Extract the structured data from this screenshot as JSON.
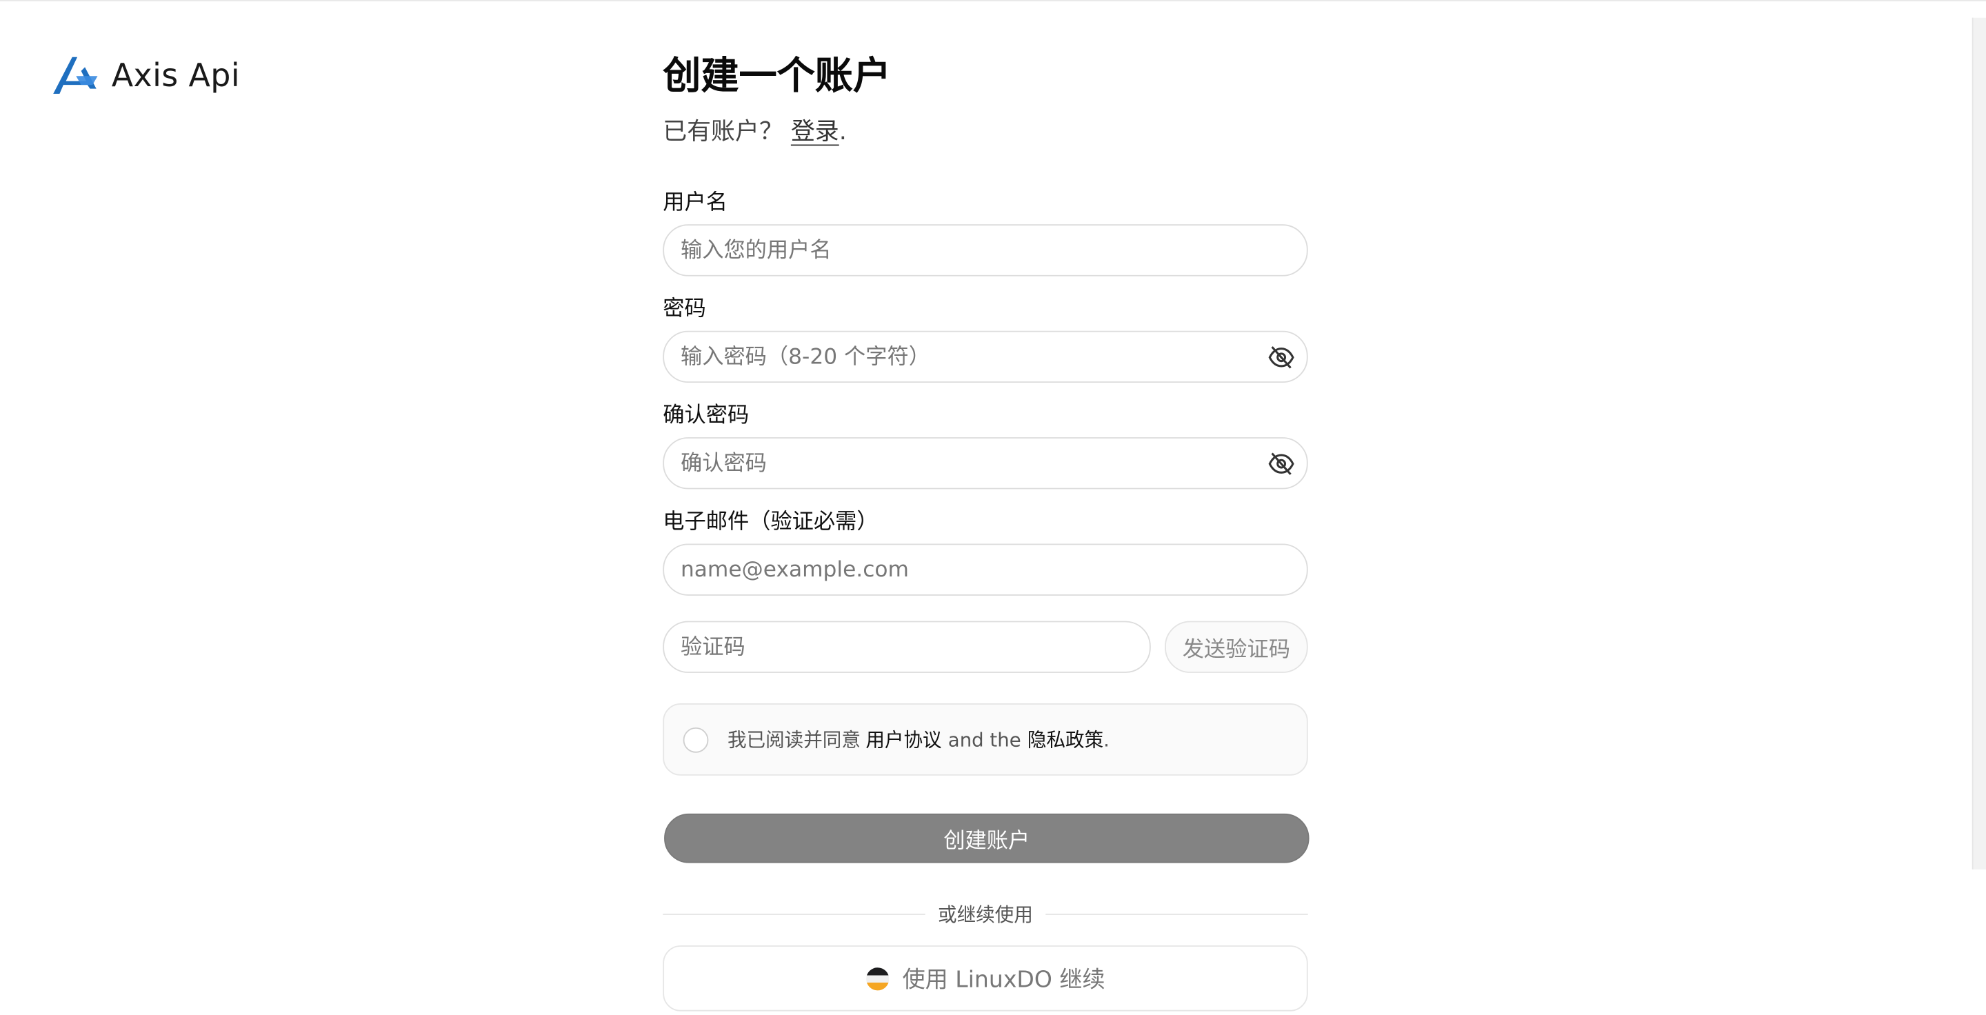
{
  "brand": {
    "name": "Axis Api",
    "logo_icon": "axis-logo-icon",
    "logo_color": "#1f6fbf"
  },
  "form": {
    "title": "创建一个账户",
    "subtitle_prefix": "已有账户？",
    "login_link": "登录",
    "subtitle_suffix": ".",
    "username": {
      "label": "用户名",
      "placeholder": "输入您的用户名",
      "value": ""
    },
    "password": {
      "label": "密码",
      "placeholder": "输入密码（8-20 个字符）",
      "value": "",
      "toggle_icon": "eye-off-icon"
    },
    "confirm_password": {
      "label": "确认密码",
      "placeholder": "确认密码",
      "value": "",
      "toggle_icon": "eye-off-icon"
    },
    "email": {
      "label": "电子邮件（验证必需）",
      "placeholder": "name@example.com",
      "value": ""
    },
    "verification": {
      "placeholder": "验证码",
      "value": "",
      "send_button": "发送验证码"
    },
    "agreement": {
      "checked": false,
      "prefix": "我已阅读并同意",
      "terms_link": "用户协议",
      "connector": "and the",
      "privacy_link": "隐私政策",
      "suffix": "."
    },
    "submit_button": "创建账户",
    "submit_color": "#838383",
    "divider_text": "或继续使用",
    "oauth_button": "使用 LinuxDO 继续",
    "oauth_icon": "linuxdo-icon"
  }
}
